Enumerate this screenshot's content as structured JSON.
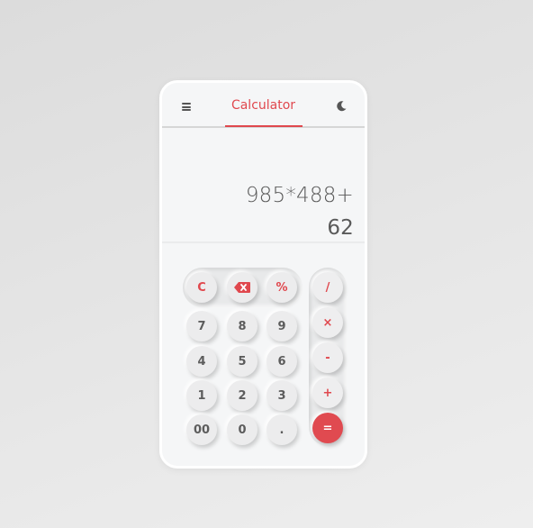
{
  "header": {
    "title": "Calculator",
    "menu_icon": "hamburger-menu-icon",
    "theme_icon": "moon-icon"
  },
  "display": {
    "expression_line1": "985*488+",
    "expression_line2": "62"
  },
  "colors": {
    "accent": "#e0484e",
    "background": "#f5f6f7",
    "key": "#ececed",
    "text": "#5a5a5a"
  },
  "keys": {
    "clear": "C",
    "backspace_icon": "backspace-icon",
    "percent": "%",
    "divide": "/",
    "multiply": "×",
    "subtract": "-",
    "add": "+",
    "equals": "=",
    "seven": "7",
    "eight": "8",
    "nine": "9",
    "four": "4",
    "five": "5",
    "six": "6",
    "one": "1",
    "two": "2",
    "three": "3",
    "double_zero": "00",
    "zero": "0",
    "decimal": "."
  }
}
